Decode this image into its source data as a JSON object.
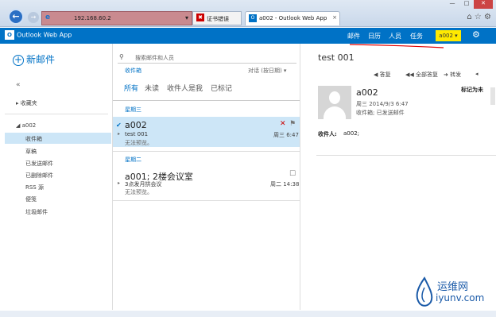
{
  "browser": {
    "back_icon": "back-arrow-icon",
    "forward_icon": "forward-arrow-icon",
    "address": "192.168.60.2",
    "cert_error": "证书错误",
    "tab_title": "a002 - Outlook Web App"
  },
  "app": {
    "name": "Outlook Web App",
    "nav": [
      "邮件",
      "日历",
      "人员",
      "任务"
    ],
    "user": "a002"
  },
  "left": {
    "new_mail": "新邮件",
    "collapse": "«",
    "favorites": "收藏夹",
    "account": "a002",
    "folders": [
      "收件箱",
      "草稿",
      "已发送邮件",
      "已删除邮件",
      "RSS 源",
      "便笺",
      "垃圾邮件"
    ]
  },
  "list": {
    "search_placeholder": "搜索邮件和人员",
    "inbox_label": "收件箱",
    "sort_label": "对话 (按日期)",
    "filters": [
      "所有",
      "未读",
      "收件人是我",
      "已标记"
    ],
    "groups": [
      {
        "header": "星期三",
        "items": [
          {
            "from": "a002",
            "subject": "test 001",
            "preview": "无法预览。",
            "time": "周三 6:47"
          }
        ]
      },
      {
        "header": "星期二",
        "items": [
          {
            "from": "a001; 2楼会议室",
            "subject": "3点发月拱会议",
            "preview": "无法预览。",
            "time": "周二 14:38"
          }
        ]
      }
    ]
  },
  "reading": {
    "title": "test 001",
    "actions": [
      "答复",
      "全部答复",
      "转发"
    ],
    "from": "a002",
    "date": "周三 2014/9/3 6:47",
    "folder": "收件箱; 已发送邮件",
    "mark_as": "标记为未",
    "to_label": "收件人:",
    "to_value": "a002;"
  },
  "watermark": {
    "cn": "运维网",
    "url": "iyunv.com"
  }
}
